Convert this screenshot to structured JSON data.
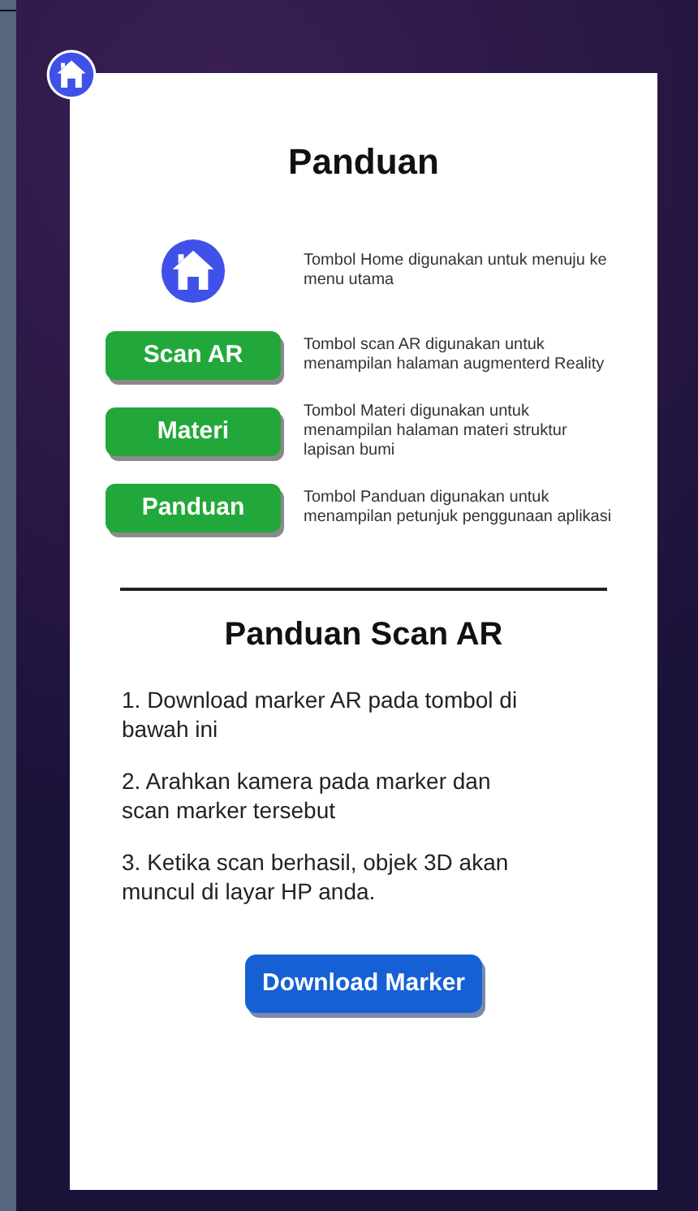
{
  "title": "Panduan",
  "guide_items": [
    {
      "kind": "home",
      "description": "Tombol Home digunakan untuk menuju ke menu utama"
    },
    {
      "kind": "button",
      "label": "Scan AR",
      "description": "Tombol scan AR digunakan untuk menampilan halaman augmenterd Reality"
    },
    {
      "kind": "button",
      "label": "Materi",
      "description": "Tombol Materi digunakan untuk menampilan halaman materi struktur lapisan bumi"
    },
    {
      "kind": "button",
      "label": "Panduan",
      "description": "Tombol Panduan digunakan untuk menampilan petunjuk penggunaan aplikasi"
    }
  ],
  "scan_guide": {
    "title": "Panduan Scan AR",
    "steps": [
      "1. Download marker AR pada tombol di bawah ini",
      "2. Arahkan kamera pada marker dan scan marker tersebut",
      "3. Ketika scan berhasil, objek 3D akan muncul di layar HP anda."
    ],
    "button": "Download Marker"
  }
}
